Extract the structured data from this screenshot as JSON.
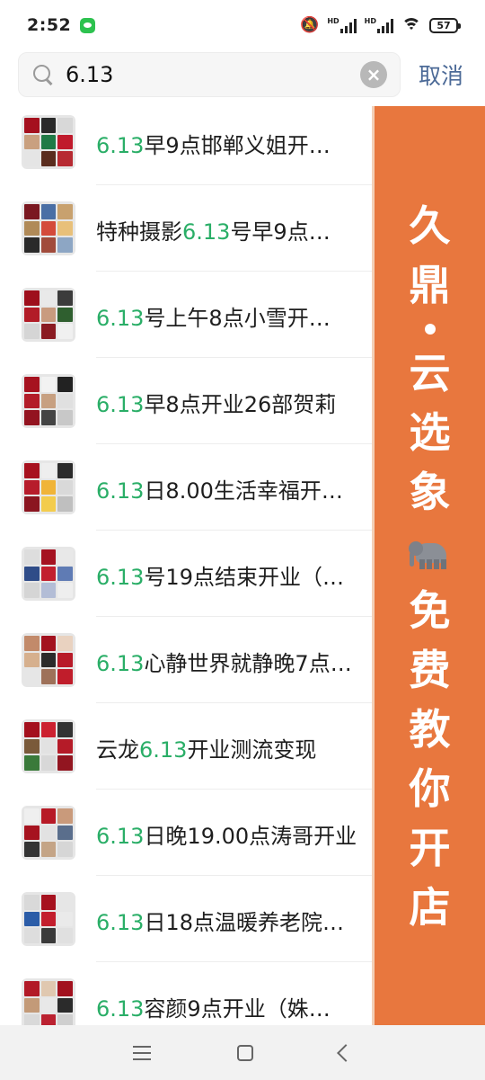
{
  "status_bar": {
    "time": "2:52",
    "battery": "57",
    "network_label": "HD"
  },
  "search": {
    "query": "6.13",
    "cancel_label": "取消"
  },
  "highlight_color": "#2aae67",
  "results": [
    {
      "pre": "",
      "hl": "6.13",
      "post": "早9点邯郸义姐开…"
    },
    {
      "pre": "特种摄影",
      "hl": "6.13",
      "post": "号早9点…"
    },
    {
      "pre": "",
      "hl": "6.13",
      "post": "号上午8点小雪开…"
    },
    {
      "pre": "",
      "hl": "6.13",
      "post": "早8点开业26部贺莉"
    },
    {
      "pre": "",
      "hl": "6.13",
      "post": "日8.00生活幸福开…"
    },
    {
      "pre": "",
      "hl": "6.13",
      "post": "号19点结束开业（…"
    },
    {
      "pre": "",
      "hl": "6.13",
      "post": "心静世界就静晚7点…"
    },
    {
      "pre": "云龙",
      "hl": "6.13",
      "post": "开业测流变现"
    },
    {
      "pre": "",
      "hl": "6.13",
      "post": "日晚19.00点涛哥开业"
    },
    {
      "pre": "",
      "hl": "6.13",
      "post": "日18点温暖养老院…"
    },
    {
      "pre": "",
      "hl": "6.13",
      "post": "容颜9点开业（姝…"
    }
  ],
  "banner": {
    "chars_top": [
      "久",
      "鼎"
    ],
    "chars_mid": [
      "云",
      "选",
      "象"
    ],
    "chars_bottom": [
      "免",
      "费",
      "教",
      "你",
      "开",
      "店"
    ],
    "bg_color": "#e8773e",
    "icon": "elephant-icon"
  },
  "nav": {
    "icons": [
      "menu-icon",
      "home-icon",
      "back-icon"
    ]
  }
}
